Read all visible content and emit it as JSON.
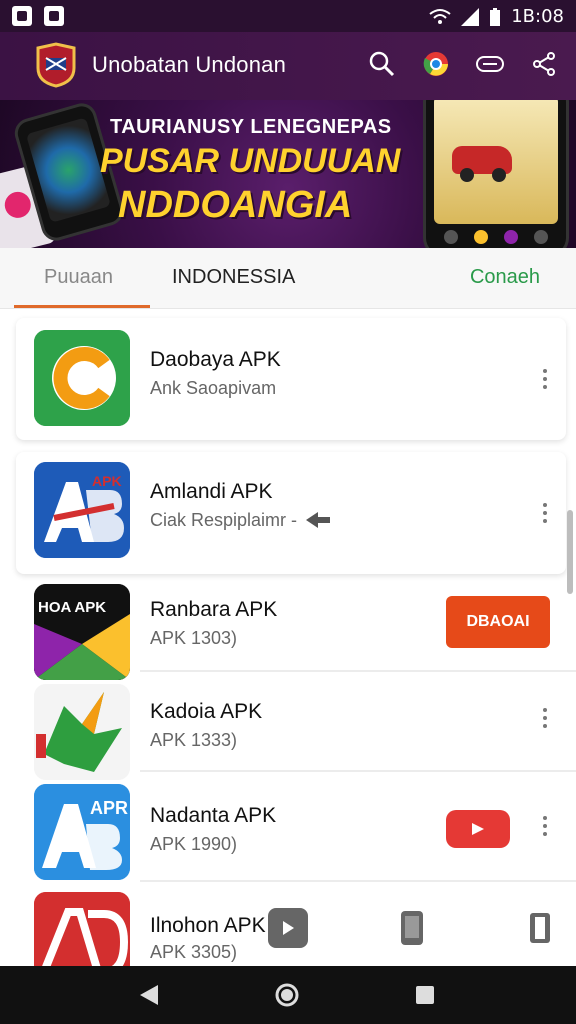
{
  "status_bar": {
    "time": "1B:08"
  },
  "app_bar": {
    "title": "Unobatan Undonan"
  },
  "banner": {
    "line1": "TAURIANUSY LENEGNEPAS",
    "line2": "PUSAR UNDUUAN",
    "line3": "NDDOANGIA"
  },
  "tabs": [
    {
      "label": "Puuaan"
    },
    {
      "label": "INDONESSIA"
    },
    {
      "label": "Conaeh"
    }
  ],
  "items": [
    {
      "title": "Daobaya APK",
      "subtitle": "Ank Saoapivam"
    },
    {
      "title": "Amlandi APK",
      "subtitle": "Ciak Respiplaimr -"
    },
    {
      "title": "Ranbara APK",
      "subtitle": "APK 1303)",
      "action": "DBAOAI"
    },
    {
      "title": "Kadoia APK",
      "subtitle": "APK 1333)"
    },
    {
      "title": "Nadanta APK",
      "subtitle": "APK 1990)"
    },
    {
      "title": "Ilnohon APK",
      "subtitle": "APK 3305)"
    }
  ],
  "icon_text": {
    "row2": "APK",
    "row3": "HOA APK",
    "row5": "APR"
  },
  "colors": {
    "accent": "#e06a2b",
    "green": "#2a9a4a",
    "dark_purple": "#3b1244"
  }
}
